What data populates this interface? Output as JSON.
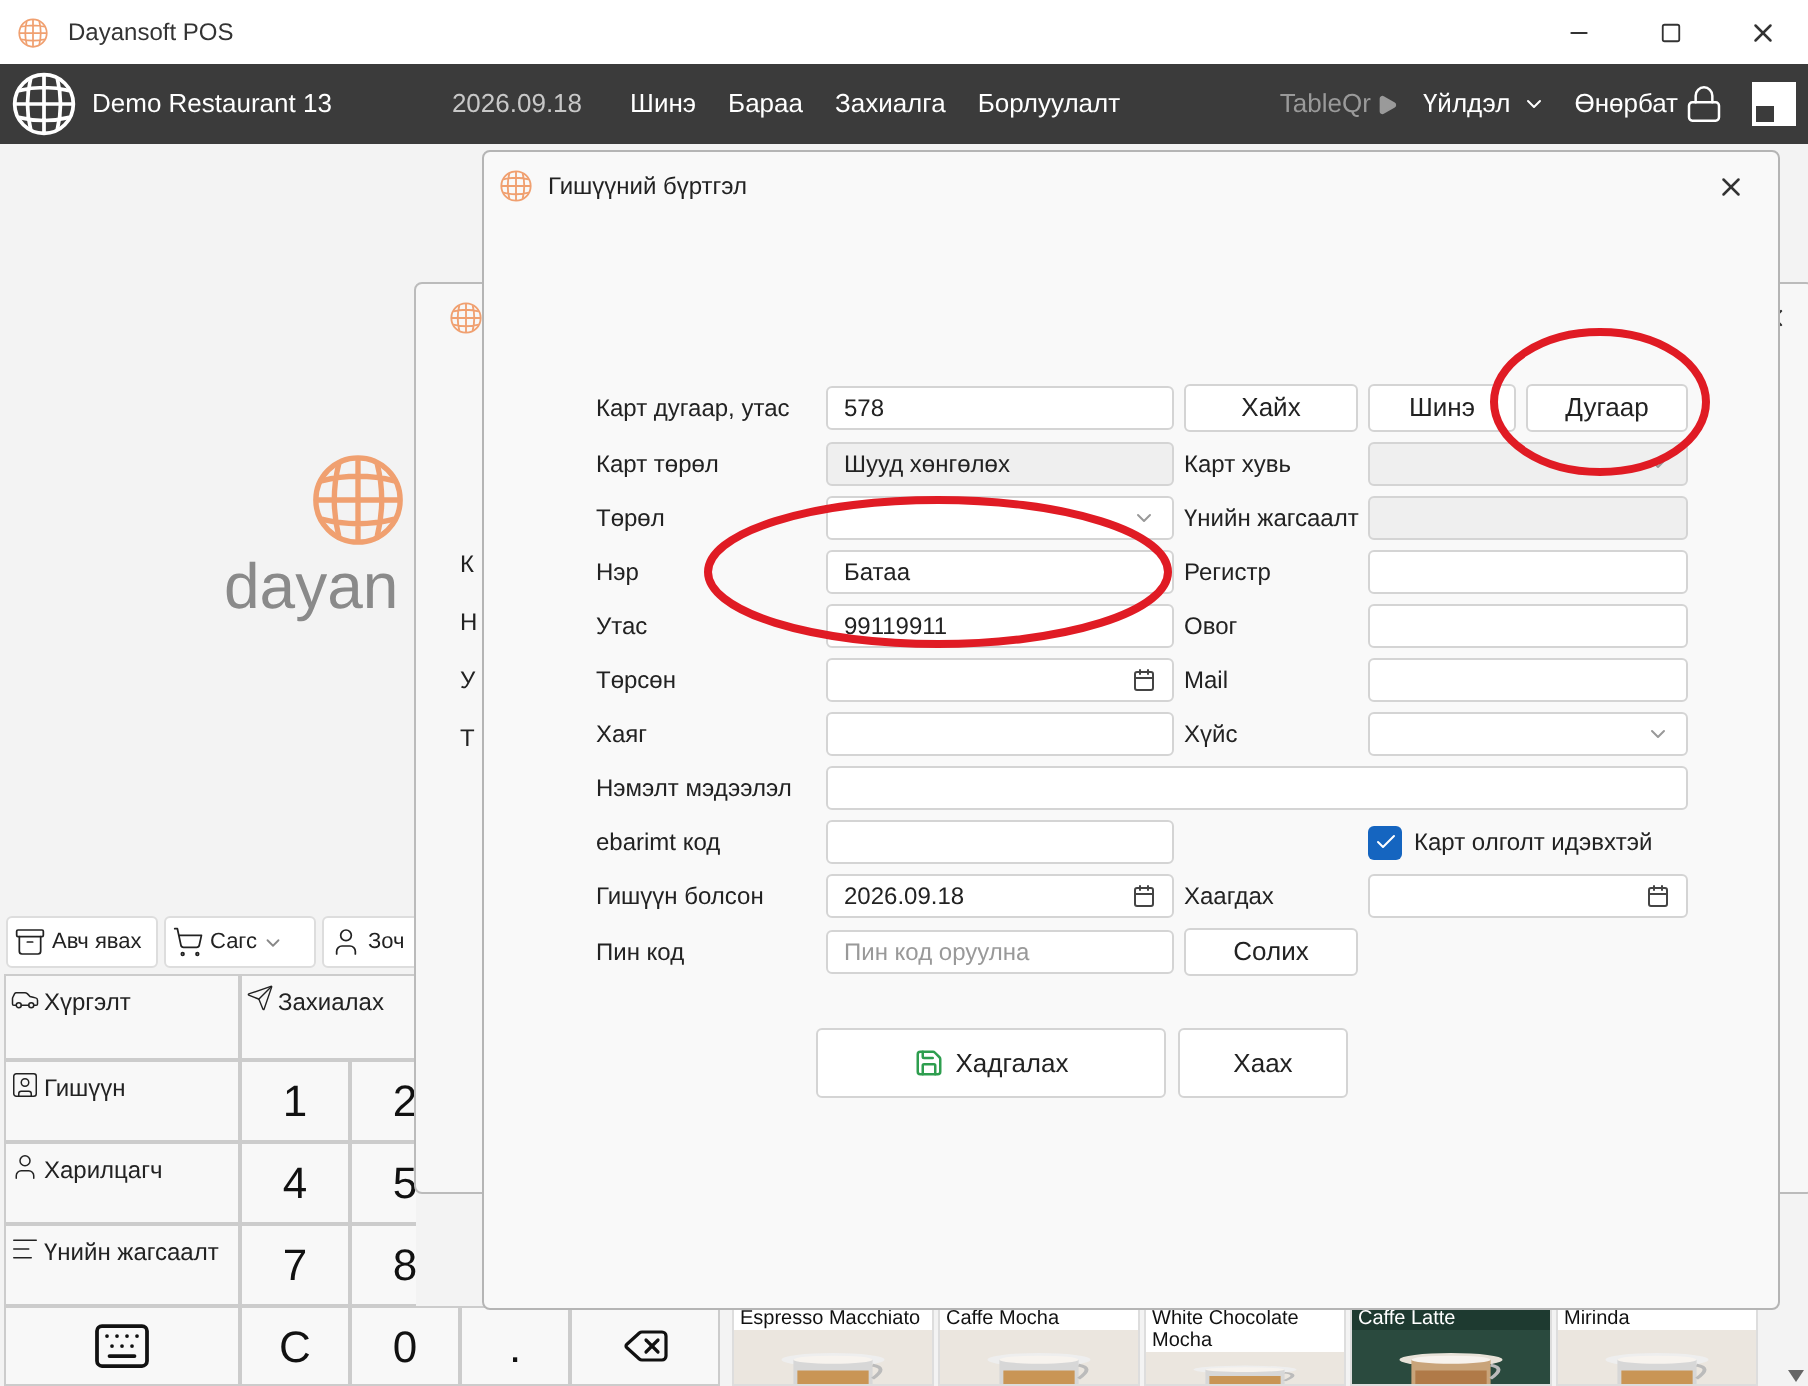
{
  "window": {
    "title": "Dayansoft POS"
  },
  "navbar": {
    "restaurant": "Demo Restaurant 13",
    "date": "2026.09.18",
    "menu": [
      "Шинэ",
      "Бараа",
      "Захиалга",
      "Борлуулалт"
    ],
    "table_qr": {
      "label": "TableQr",
      "disabled": true
    },
    "actions": "Үйлдэл",
    "user": "Өнөрбат"
  },
  "background": {
    "logo_text": "dayan",
    "order_buttons": [
      {
        "label": "Авч явах",
        "kind": "takeaway"
      },
      {
        "label": "Сагс",
        "kind": "cart"
      },
      {
        "label": "Зоч",
        "kind": "guest"
      }
    ],
    "side_buttons": [
      {
        "label": "Хүргэлт",
        "kind": "delivery"
      },
      {
        "label": "Гишүүн",
        "kind": "member"
      },
      {
        "label": "Харилцагч",
        "kind": "customer"
      },
      {
        "label": "Үнийн жагсаалт",
        "kind": "pricelist"
      }
    ],
    "order_label": "Захиалах",
    "keys": [
      [
        "1",
        "2"
      ],
      [
        "4",
        "5"
      ],
      [
        "7",
        "8"
      ]
    ],
    "bottom_keys": [
      {
        "kind": "keyboard"
      },
      {
        "kind": "key",
        "label": "C"
      },
      {
        "kind": "key",
        "label": "0"
      },
      {
        "kind": "key",
        "label": "."
      },
      {
        "kind": "backspace"
      }
    ],
    "products": [
      {
        "label": "Espresso Macchiato",
        "kind": "light"
      },
      {
        "label": "Caffe Mocha",
        "kind": "light"
      },
      {
        "label": "White Chocolate Mocha",
        "kind": "light"
      },
      {
        "label": "Caffe Latte",
        "kind": "dark"
      },
      {
        "label": "Mirinda",
        "kind": "light"
      }
    ]
  },
  "back_dialog": {
    "labels": [
      "К",
      "Н",
      "У",
      "Т"
    ]
  },
  "dialog": {
    "title": "Гишүүний бүртгэл",
    "rows": [
      {
        "label": "Карт дугаар, утас",
        "field": {
          "kind": "text",
          "value": "578"
        },
        "right": {
          "kind": "buttons",
          "buttons": [
            "Хайх",
            "Шинэ",
            "Дугаар"
          ]
        }
      },
      {
        "label": "Карт төрөл",
        "field": {
          "kind": "readonly",
          "value": "Шууд хөнгөлөх"
        },
        "right": {
          "kind": "field",
          "label": "Карт хувь",
          "field": {
            "kind": "select",
            "disabled": true
          }
        }
      },
      {
        "label": "Төрөл",
        "field": {
          "kind": "select",
          "disabled": false
        },
        "right": {
          "kind": "field",
          "label": "Үнийн жагсаалт",
          "field": {
            "kind": "readonly"
          }
        }
      },
      {
        "label": "Нэр",
        "field": {
          "kind": "text",
          "value": "Батаа"
        },
        "right": {
          "kind": "field",
          "label": "Регистр",
          "field": {
            "kind": "text"
          }
        }
      },
      {
        "label": "Утас",
        "field": {
          "kind": "text",
          "value": "99119911"
        },
        "right": {
          "kind": "field",
          "label": "Овог",
          "field": {
            "kind": "text"
          }
        }
      },
      {
        "label": "Төрсөн",
        "field": {
          "kind": "date"
        },
        "right": {
          "kind": "field",
          "label": "Mail",
          "field": {
            "kind": "text"
          }
        }
      },
      {
        "label": "Хаяг",
        "field": {
          "kind": "text"
        },
        "right": {
          "kind": "field",
          "label": "Хүйс",
          "field": {
            "kind": "select",
            "disabled": false
          }
        }
      },
      {
        "label": "Нэмэлт мэдээлэл",
        "field": {
          "kind": "wide"
        }
      },
      {
        "label": "ebarimt код",
        "field": {
          "kind": "text"
        },
        "right": {
          "kind": "checkbox",
          "label": "Карт олголт идэвхтэй",
          "checked": true
        }
      },
      {
        "label": "Гишүүн болсон",
        "field": {
          "kind": "date",
          "value": "2026.09.18"
        },
        "right": {
          "kind": "field",
          "label": "Хаагдах",
          "field": {
            "kind": "date"
          }
        }
      },
      {
        "label": "Пин код",
        "field": {
          "kind": "text",
          "placeholder": "Пин код оруулна"
        },
        "right": {
          "kind": "button",
          "label": "Солих"
        }
      }
    ],
    "save": "Хадгалах",
    "close": "Хаах"
  }
}
